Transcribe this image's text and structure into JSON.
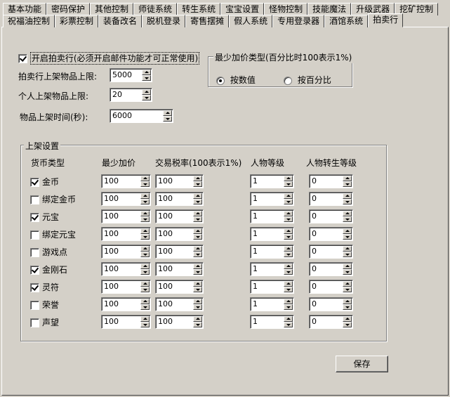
{
  "tabs_row1": [
    "基本功能",
    "密码保护",
    "其他控制",
    "师徒系统",
    "转生系统",
    "宝宝设置",
    "怪物控制",
    "技能魔法",
    "升级武器",
    "挖矿控制"
  ],
  "tabs_row2": [
    "祝福油控制",
    "彩票控制",
    "装备改名",
    "脱机登录",
    "寄售摆摊",
    "假人系统",
    "专用登录器",
    "酒馆系统",
    "拍卖行"
  ],
  "active_tab": "拍卖行",
  "auction": {
    "enable_label": "开启拍卖行(必须开启邮件功能才可正常使用)",
    "enable_checked": true,
    "limits": [
      {
        "label": "拍卖行上架物品上限:",
        "value": "5000"
      },
      {
        "label": "个人上架物品上限:",
        "value": "20"
      },
      {
        "label": "物品上架时间(秒):",
        "value": "6000"
      }
    ]
  },
  "min_increase": {
    "title": "最少加价类型(百分比时100表示1%)",
    "options": [
      {
        "label": "按数值",
        "selected": true
      },
      {
        "label": "按百分比",
        "selected": false
      }
    ]
  },
  "listing": {
    "title": "上架设置",
    "headers": [
      "货币类型",
      "最少加价",
      "交易税率(100表示1%)",
      "人物等级",
      "人物转生等级"
    ],
    "rows": [
      {
        "currency": "金币",
        "checked": true,
        "min_increase": "100",
        "tax": "100",
        "level": "1",
        "rebirth": "0"
      },
      {
        "currency": "绑定金币",
        "checked": false,
        "min_increase": "100",
        "tax": "100",
        "level": "1",
        "rebirth": "0"
      },
      {
        "currency": "元宝",
        "checked": true,
        "min_increase": "100",
        "tax": "100",
        "level": "1",
        "rebirth": "0"
      },
      {
        "currency": "绑定元宝",
        "checked": false,
        "min_increase": "100",
        "tax": "100",
        "level": "1",
        "rebirth": "0"
      },
      {
        "currency": "游戏点",
        "checked": false,
        "min_increase": "100",
        "tax": "100",
        "level": "1",
        "rebirth": "0"
      },
      {
        "currency": "金刚石",
        "checked": true,
        "min_increase": "100",
        "tax": "100",
        "level": "1",
        "rebirth": "0"
      },
      {
        "currency": "灵符",
        "checked": true,
        "min_increase": "100",
        "tax": "100",
        "level": "1",
        "rebirth": "0"
      },
      {
        "currency": "荣誉",
        "checked": false,
        "min_increase": "100",
        "tax": "100",
        "level": "1",
        "rebirth": "0"
      },
      {
        "currency": "声望",
        "checked": false,
        "min_increase": "100",
        "tax": "100",
        "level": "1",
        "rebirth": "0"
      }
    ]
  },
  "save_label": "保存"
}
